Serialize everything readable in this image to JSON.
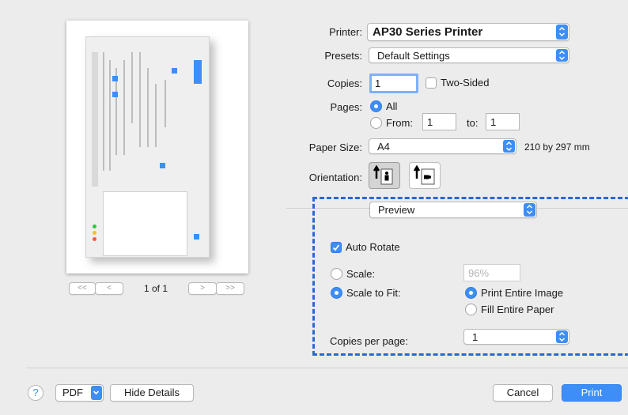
{
  "preview": {
    "page_indicator": "1 of 1",
    "nav_first": "<<",
    "nav_prev": "<",
    "nav_next": ">",
    "nav_last": ">>"
  },
  "printer": {
    "label": "Printer:",
    "value": "AP30 Series Printer"
  },
  "presets": {
    "label": "Presets:",
    "value": "Default Settings"
  },
  "copies": {
    "label": "Copies:",
    "value": "1",
    "two_sided_label": "Two-Sided",
    "two_sided_checked": false
  },
  "pages": {
    "label": "Pages:",
    "all_label": "All",
    "from_label": "From:",
    "from_value": "1",
    "to_label": "to:",
    "to_value": "1",
    "selected": "All"
  },
  "paper_size": {
    "label": "Paper Size:",
    "value": "A4",
    "dimensions": "210 by 297 mm"
  },
  "orientation": {
    "label": "Orientation:",
    "selected": "portrait"
  },
  "section_popup": {
    "value": "Preview"
  },
  "preview_options": {
    "auto_rotate_label": "Auto Rotate",
    "auto_rotate_checked": true,
    "scale_label": "Scale:",
    "scale_value": "96%",
    "scale_to_fit_label": "Scale to Fit:",
    "scale_to_fit_selected": true,
    "print_entire_image_label": "Print Entire Image",
    "fill_entire_paper_label": "Fill Entire Paper",
    "copies_per_page_label": "Copies per page:",
    "copies_per_page_value": "1"
  },
  "footer": {
    "help_label": "?",
    "pdf_label": "PDF",
    "hide_details_label": "Hide Details",
    "cancel_label": "Cancel",
    "print_label": "Print"
  },
  "colors": {
    "accent": "#3d8ef6",
    "highlight_border": "#2d67d6",
    "background": "#ececec"
  }
}
